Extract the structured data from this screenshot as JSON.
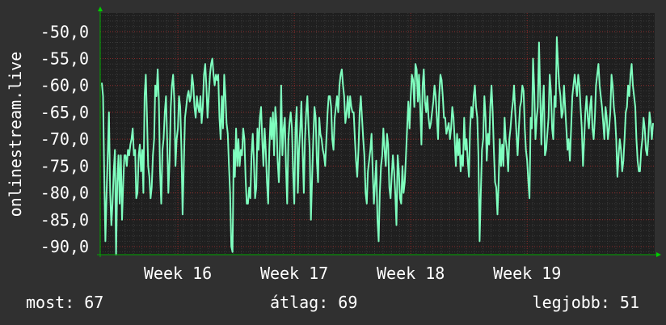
{
  "chart_data": {
    "type": "line",
    "ylabel": "onlinestream.live",
    "ylim": [
      -91.5,
      -46.5
    ],
    "yticks": [
      -50,
      -55,
      -60,
      -65,
      -70,
      -75,
      -80,
      -85,
      -90
    ],
    "ytick_labels": [
      "-50,0",
      "-55,0",
      "-60,0",
      "-65,0",
      "-70,0",
      "-75,0",
      "-80,0",
      "-85,0",
      "-90,0"
    ],
    "xlim": [
      0,
      100
    ],
    "xticks": [
      {
        "label": "Week 16",
        "pos": 14
      },
      {
        "label": "Week 17",
        "pos": 35
      },
      {
        "label": "Week 18",
        "pos": 56
      },
      {
        "label": "Week 19",
        "pos": 77
      }
    ],
    "grid": true,
    "colors": {
      "line": "#7fffbf",
      "plot_bg": "#1f1f1f",
      "page_bg": "#303030",
      "grid": "#8a2a2a",
      "axis_arrow": "#00cc00"
    },
    "series": [
      {
        "values": [
          -59.5,
          -62,
          -76,
          -89,
          -80,
          -73,
          -65,
          -80,
          -86,
          -82,
          -76,
          -72,
          -91.5,
          -78,
          -73,
          -82,
          -73,
          -85,
          -78,
          -73,
          -73,
          -75,
          -72,
          -73,
          -71,
          -70,
          -68,
          -73,
          -72,
          -81,
          -80,
          -73,
          -71,
          -76,
          -72,
          -80,
          -62,
          -58,
          -66,
          -75,
          -77,
          -81,
          -79,
          -73,
          -70,
          -60,
          -62,
          -57,
          -63,
          -76,
          -82,
          -72,
          -70,
          -65,
          -62,
          -70,
          -80,
          -74,
          -64,
          -60,
          -58,
          -63,
          -75,
          -70,
          -68,
          -62,
          -64,
          -72,
          -84,
          -75,
          -66,
          -64,
          -62,
          -61,
          -63,
          -62,
          -58,
          -60,
          -64,
          -66,
          -62,
          -64,
          -65,
          -62,
          -67,
          -64,
          -58,
          -56,
          -60,
          -66,
          -62,
          -58,
          -56,
          -55,
          -58,
          -60,
          -58,
          -59,
          -58,
          -66,
          -70,
          -62,
          -68,
          -58,
          -62,
          -67,
          -69,
          -75,
          -80,
          -90,
          -91,
          -72,
          -77,
          -68,
          -75,
          -70,
          -75,
          -72,
          -73,
          -68,
          -70,
          -77,
          -82,
          -82,
          -79,
          -81,
          -73,
          -69,
          -74,
          -81,
          -79,
          -68,
          -72,
          -66,
          -64,
          -70,
          -75,
          -68,
          -72,
          -78,
          -82,
          -72,
          -66,
          -70,
          -65,
          -73,
          -64,
          -67,
          -74,
          -78,
          -71,
          -60,
          -73,
          -68,
          -66,
          -75,
          -82,
          -70,
          -67,
          -65,
          -68,
          -76,
          -82,
          -68,
          -64,
          -80,
          -72,
          -68,
          -63,
          -72,
          -80,
          -70,
          -65,
          -62,
          -68,
          -72,
          -85,
          -77,
          -70,
          -64,
          -66,
          -74,
          -78,
          -66,
          -69,
          -70,
          -72,
          -73,
          -75,
          -70,
          -65,
          -62,
          -62,
          -64,
          -70,
          -72,
          -66,
          -64,
          -62,
          -65,
          -60,
          -58,
          -57,
          -60,
          -62,
          -67,
          -65,
          -62,
          -66,
          -62,
          -64,
          -65,
          -65,
          -70,
          -74,
          -77,
          -72,
          -65,
          -62,
          -66,
          -70,
          -73,
          -80,
          -82,
          -76,
          -74,
          -72,
          -69,
          -76,
          -82,
          -78,
          -74,
          -85,
          -89,
          -80,
          -75,
          -73,
          -68,
          -72,
          -75,
          -69,
          -71,
          -79,
          -81,
          -77,
          -73,
          -76,
          -80,
          -86,
          -73,
          -76,
          -81,
          -82,
          -75,
          -80,
          -78,
          -73,
          -68,
          -63,
          -68,
          -62,
          -58,
          -59,
          -64,
          -56,
          -57,
          -63,
          -58,
          -64,
          -71,
          -60,
          -57,
          -63,
          -65,
          -62,
          -66,
          -68,
          -67,
          -65,
          -63,
          -60,
          -62,
          -66,
          -70,
          -62,
          -58,
          -59,
          -62,
          -66,
          -66,
          -69,
          -68,
          -67,
          -70,
          -68,
          -64,
          -66,
          -70,
          -75,
          -69,
          -73,
          -70,
          -76,
          -73,
          -75,
          -66,
          -72,
          -70,
          -74,
          -77,
          -68,
          -64,
          -66,
          -62,
          -60,
          -64,
          -66,
          -73,
          -89,
          -80,
          -72,
          -70,
          -62,
          -66,
          -74,
          -69,
          -71,
          -64,
          -60,
          -65,
          -72,
          -78,
          -79,
          -84,
          -78,
          -70,
          -75,
          -71,
          -75,
          -66,
          -70,
          -72,
          -76,
          -70,
          -68,
          -65,
          -63,
          -60,
          -65,
          -69,
          -73,
          -68,
          -64,
          -63,
          -60,
          -61,
          -68,
          -72,
          -74,
          -78,
          -81,
          -66,
          -68,
          -55,
          -61,
          -70,
          -66,
          -64,
          -52,
          -62,
          -71,
          -64,
          -60,
          -73,
          -72,
          -69,
          -66,
          -58,
          -61,
          -68,
          -70,
          -62,
          -64,
          -51,
          -56,
          -60,
          -62,
          -66,
          -65,
          -60,
          -64,
          -68,
          -72,
          -70,
          -74,
          -68,
          -62,
          -60,
          -58,
          -60,
          -62,
          -58,
          -60,
          -64,
          -68,
          -75,
          -70,
          -65,
          -62,
          -66,
          -68,
          -64,
          -62,
          -68,
          -70,
          -66,
          -60,
          -58,
          -56,
          -60,
          -62,
          -64,
          -67,
          -70,
          -64,
          -66,
          -70,
          -68,
          -65,
          -58,
          -60,
          -64,
          -66,
          -70,
          -77,
          -73,
          -70,
          -72,
          -76,
          -74,
          -70,
          -65,
          -64,
          -60,
          -62,
          -58,
          -56,
          -60,
          -62,
          -64,
          -70,
          -74,
          -76,
          -76,
          -72,
          -70,
          -66,
          -68,
          -72,
          -73,
          -70,
          -65,
          -67,
          -70,
          -67
        ]
      }
    ]
  },
  "stats": {
    "now": "most: 67",
    "avg": "átlag: 69",
    "best": "legjobb: 51"
  }
}
